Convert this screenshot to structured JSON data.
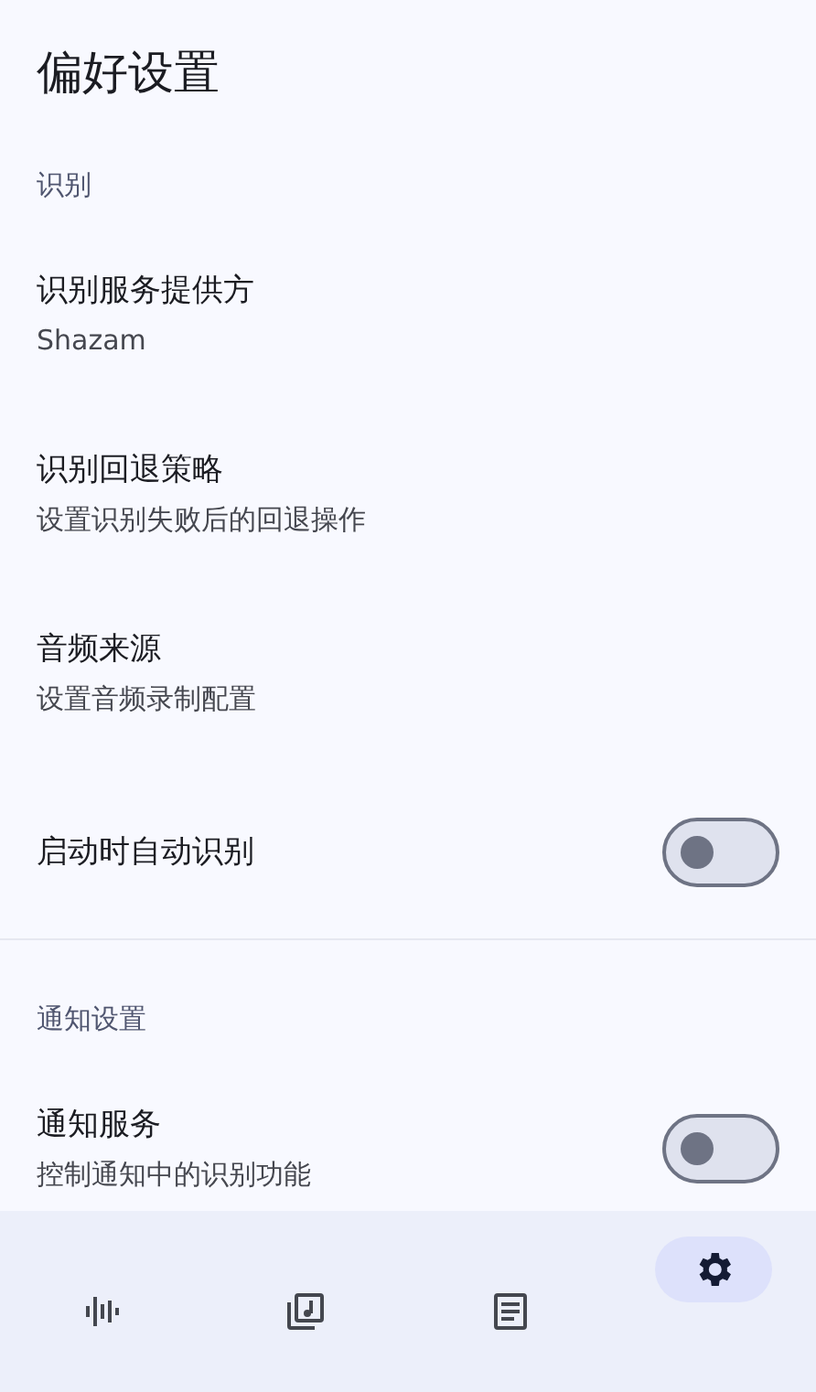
{
  "title": "偏好设置",
  "sections": [
    {
      "header": "识别",
      "items": [
        {
          "kind": "text",
          "title": "识别服务提供方",
          "subtitle": "Shazam"
        },
        {
          "kind": "text",
          "title": "识别回退策略",
          "subtitle": "设置识别失败后的回退操作"
        },
        {
          "kind": "text",
          "title": "音频来源",
          "subtitle": "设置音频录制配置"
        },
        {
          "kind": "switch",
          "title": "启动时自动识别",
          "on": false
        }
      ]
    },
    {
      "header": "通知设置",
      "items": [
        {
          "kind": "switch",
          "title": "通知服务",
          "subtitle": "控制通知中的识别功能",
          "on": false
        }
      ]
    }
  ],
  "nav": [
    {
      "selected": false
    },
    {
      "selected": false
    },
    {
      "selected": false
    },
    {
      "selected": true
    }
  ]
}
